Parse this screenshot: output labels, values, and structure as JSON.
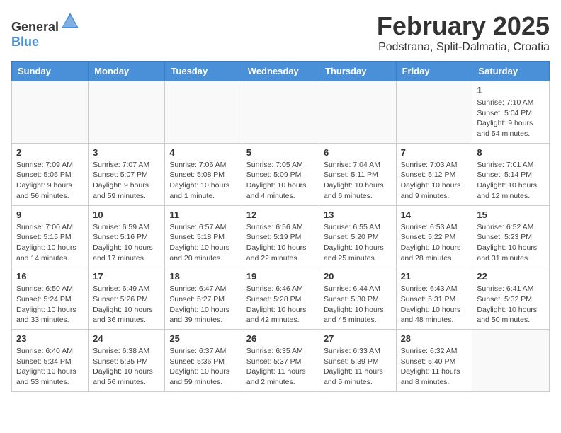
{
  "header": {
    "logo_general": "General",
    "logo_blue": "Blue",
    "month": "February 2025",
    "location": "Podstrana, Split-Dalmatia, Croatia"
  },
  "days_of_week": [
    "Sunday",
    "Monday",
    "Tuesday",
    "Wednesday",
    "Thursday",
    "Friday",
    "Saturday"
  ],
  "weeks": [
    [
      {
        "day": "",
        "info": ""
      },
      {
        "day": "",
        "info": ""
      },
      {
        "day": "",
        "info": ""
      },
      {
        "day": "",
        "info": ""
      },
      {
        "day": "",
        "info": ""
      },
      {
        "day": "",
        "info": ""
      },
      {
        "day": "1",
        "info": "Sunrise: 7:10 AM\nSunset: 5:04 PM\nDaylight: 9 hours and 54 minutes."
      }
    ],
    [
      {
        "day": "2",
        "info": "Sunrise: 7:09 AM\nSunset: 5:05 PM\nDaylight: 9 hours and 56 minutes."
      },
      {
        "day": "3",
        "info": "Sunrise: 7:07 AM\nSunset: 5:07 PM\nDaylight: 9 hours and 59 minutes."
      },
      {
        "day": "4",
        "info": "Sunrise: 7:06 AM\nSunset: 5:08 PM\nDaylight: 10 hours and 1 minute."
      },
      {
        "day": "5",
        "info": "Sunrise: 7:05 AM\nSunset: 5:09 PM\nDaylight: 10 hours and 4 minutes."
      },
      {
        "day": "6",
        "info": "Sunrise: 7:04 AM\nSunset: 5:11 PM\nDaylight: 10 hours and 6 minutes."
      },
      {
        "day": "7",
        "info": "Sunrise: 7:03 AM\nSunset: 5:12 PM\nDaylight: 10 hours and 9 minutes."
      },
      {
        "day": "8",
        "info": "Sunrise: 7:01 AM\nSunset: 5:14 PM\nDaylight: 10 hours and 12 minutes."
      }
    ],
    [
      {
        "day": "9",
        "info": "Sunrise: 7:00 AM\nSunset: 5:15 PM\nDaylight: 10 hours and 14 minutes."
      },
      {
        "day": "10",
        "info": "Sunrise: 6:59 AM\nSunset: 5:16 PM\nDaylight: 10 hours and 17 minutes."
      },
      {
        "day": "11",
        "info": "Sunrise: 6:57 AM\nSunset: 5:18 PM\nDaylight: 10 hours and 20 minutes."
      },
      {
        "day": "12",
        "info": "Sunrise: 6:56 AM\nSunset: 5:19 PM\nDaylight: 10 hours and 22 minutes."
      },
      {
        "day": "13",
        "info": "Sunrise: 6:55 AM\nSunset: 5:20 PM\nDaylight: 10 hours and 25 minutes."
      },
      {
        "day": "14",
        "info": "Sunrise: 6:53 AM\nSunset: 5:22 PM\nDaylight: 10 hours and 28 minutes."
      },
      {
        "day": "15",
        "info": "Sunrise: 6:52 AM\nSunset: 5:23 PM\nDaylight: 10 hours and 31 minutes."
      }
    ],
    [
      {
        "day": "16",
        "info": "Sunrise: 6:50 AM\nSunset: 5:24 PM\nDaylight: 10 hours and 33 minutes."
      },
      {
        "day": "17",
        "info": "Sunrise: 6:49 AM\nSunset: 5:26 PM\nDaylight: 10 hours and 36 minutes."
      },
      {
        "day": "18",
        "info": "Sunrise: 6:47 AM\nSunset: 5:27 PM\nDaylight: 10 hours and 39 minutes."
      },
      {
        "day": "19",
        "info": "Sunrise: 6:46 AM\nSunset: 5:28 PM\nDaylight: 10 hours and 42 minutes."
      },
      {
        "day": "20",
        "info": "Sunrise: 6:44 AM\nSunset: 5:30 PM\nDaylight: 10 hours and 45 minutes."
      },
      {
        "day": "21",
        "info": "Sunrise: 6:43 AM\nSunset: 5:31 PM\nDaylight: 10 hours and 48 minutes."
      },
      {
        "day": "22",
        "info": "Sunrise: 6:41 AM\nSunset: 5:32 PM\nDaylight: 10 hours and 50 minutes."
      }
    ],
    [
      {
        "day": "23",
        "info": "Sunrise: 6:40 AM\nSunset: 5:34 PM\nDaylight: 10 hours and 53 minutes."
      },
      {
        "day": "24",
        "info": "Sunrise: 6:38 AM\nSunset: 5:35 PM\nDaylight: 10 hours and 56 minutes."
      },
      {
        "day": "25",
        "info": "Sunrise: 6:37 AM\nSunset: 5:36 PM\nDaylight: 10 hours and 59 minutes."
      },
      {
        "day": "26",
        "info": "Sunrise: 6:35 AM\nSunset: 5:37 PM\nDaylight: 11 hours and 2 minutes."
      },
      {
        "day": "27",
        "info": "Sunrise: 6:33 AM\nSunset: 5:39 PM\nDaylight: 11 hours and 5 minutes."
      },
      {
        "day": "28",
        "info": "Sunrise: 6:32 AM\nSunset: 5:40 PM\nDaylight: 11 hours and 8 minutes."
      },
      {
        "day": "",
        "info": ""
      }
    ]
  ]
}
